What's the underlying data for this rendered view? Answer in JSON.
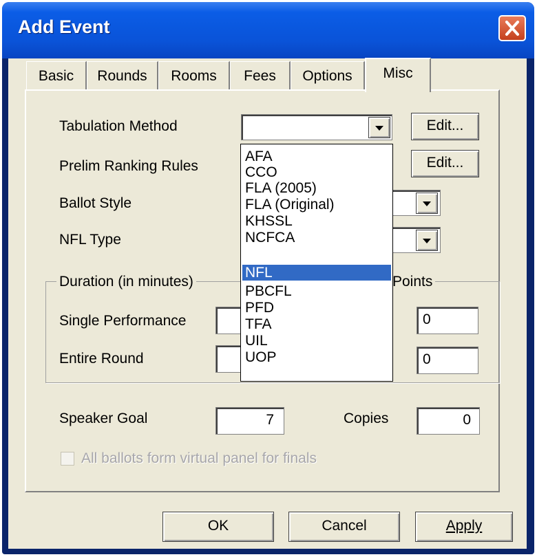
{
  "window": {
    "title": "Add Event"
  },
  "tabs": [
    "Basic",
    "Rounds",
    "Rooms",
    "Fees",
    "Options",
    "Misc"
  ],
  "active_tab": "Misc",
  "fields": {
    "tabulation_method": {
      "label": "Tabulation Method",
      "value": "",
      "edit_label": "Edit..."
    },
    "prelim_ranking_rules": {
      "label": "Prelim Ranking Rules",
      "edit_label": "Edit..."
    },
    "ballot_style": {
      "label": "Ballot Style"
    },
    "nfl_type": {
      "label": "NFL Type"
    }
  },
  "duration_group": {
    "legend": "Duration (in minutes)",
    "single_performance": "Single Performance",
    "entire_round": "Entire Round"
  },
  "points_group": {
    "legend": "Points",
    "value1": "0",
    "value2": "0"
  },
  "speaker_goal": {
    "label": "Speaker Goal",
    "value": "7"
  },
  "copies": {
    "label": "Copies",
    "value": "0"
  },
  "virtual_panel_checkbox": {
    "label": "All ballots form virtual panel for finals",
    "checked": false,
    "enabled": false
  },
  "dropdown_options": [
    "AFA",
    "CCO",
    "FLA (2005)",
    "FLA (Original)",
    "KHSSL",
    "NCFCA",
    "NFL",
    "PBCFL",
    "PFD",
    "TFA",
    "UIL",
    "UOP"
  ],
  "dropdown_selected": "NFL",
  "buttons": {
    "ok": "OK",
    "cancel": "Cancel",
    "apply": "Apply"
  },
  "colors": {
    "titlebar": "#0a53d8",
    "face": "#ece9d8",
    "selection": "#316ac5"
  }
}
